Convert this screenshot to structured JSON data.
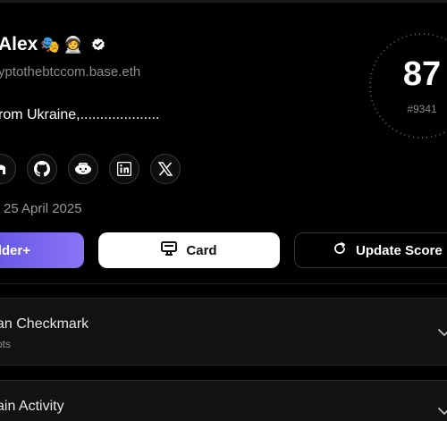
{
  "profile": {
    "name": "Alex",
    "emojis": [
      "🎭",
      "🧑‍🚀"
    ],
    "handle": "yptothebtccom.base.eth",
    "bio": "rom Ukraine,....................",
    "joined": "25 April 2025",
    "socials": [
      "website-icon",
      "github-icon",
      "farcaster-icon",
      "linkedin-icon",
      "x-icon"
    ]
  },
  "score": {
    "value": "87",
    "rank": "#9341"
  },
  "actions": {
    "builder_label": "lder+",
    "card_label": "Card",
    "update_label": "Update Score"
  },
  "sections": [
    {
      "title": "an Checkmark",
      "subtitle": "pts"
    },
    {
      "title": "ain Activity"
    }
  ],
  "colors": {
    "accent_start": "#5b4fe0",
    "accent_end": "#8b74f5",
    "background": "#000000"
  }
}
